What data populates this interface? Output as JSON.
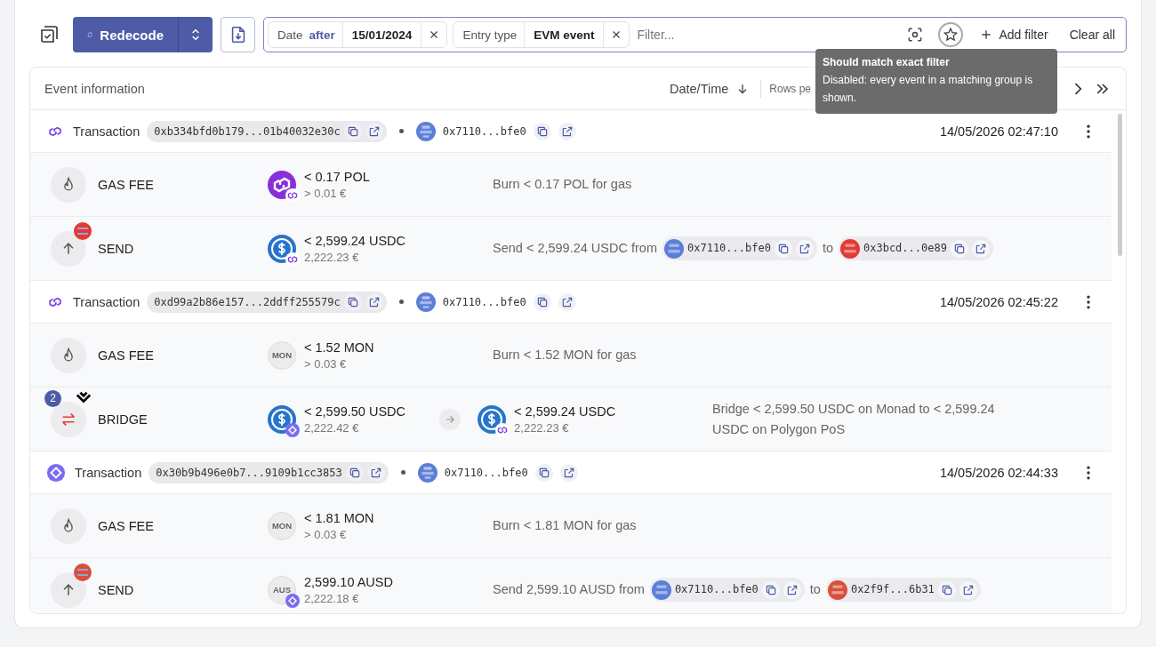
{
  "toolbar": {
    "redecode": "Redecode"
  },
  "filter_bar": {
    "chips": [
      {
        "key": "Date",
        "operator": "after",
        "value": "15/01/2024"
      },
      {
        "key": "Entry type",
        "value": "EVM event"
      }
    ],
    "placeholder": "Filter...",
    "add": "Add filter",
    "clear": "Clear all"
  },
  "tooltip": {
    "title": "Should match exact filter",
    "text": "Disabled: every event in a matching group is shown."
  },
  "table": {
    "title": "Event information",
    "sort": "Date/Time",
    "rows_per_page": "Rows pe"
  },
  "groups": [
    {
      "kind": "polygon",
      "label": "Transaction",
      "hash": "0xb334bfd0b179...01b40032e30c",
      "wallet": {
        "text": "0x7110...bfe0",
        "color": "#5b7fd8"
      },
      "datetime": "14/05/2026 02:47:10",
      "events": [
        {
          "kind": "gas",
          "label": "GAS FEE",
          "assets": [
            {
              "token": {
                "kind": "pol"
              },
              "network": {
                "kind": "polygon"
              },
              "amount": "< 0.17 POL",
              "value": "> 0.01 €"
            }
          ],
          "description": [
            {
              "kind": "text",
              "text": "Burn < 0.17 POL for gas"
            }
          ]
        },
        {
          "kind": "send",
          "label": "SEND",
          "counterparty": {
            "color": "#e53935"
          },
          "assets": [
            {
              "token": {
                "kind": "usdc"
              },
              "network": {
                "kind": "polygon"
              },
              "amount": "< 2,599.24 USDC",
              "value": "2,222.23 €"
            }
          ],
          "description": [
            {
              "kind": "text",
              "text": "Send < 2,599.24 USDC from"
            },
            {
              "kind": "address",
              "text": "0x7110...bfe0",
              "color": "#5b7fd8"
            },
            {
              "kind": "text",
              "text": "to"
            },
            {
              "kind": "address",
              "text": "0x3bcd...0e89",
              "color": "#e53935"
            }
          ]
        }
      ]
    },
    {
      "kind": "polygon",
      "label": "Transaction",
      "hash": "0xd99a2b86e157...2ddff255579c",
      "wallet": {
        "text": "0x7110...bfe0",
        "color": "#5b7fd8"
      },
      "datetime": "14/05/2026 02:45:22",
      "events": [
        {
          "kind": "gas",
          "label": "GAS FEE",
          "assets": [
            {
              "token": {
                "kind": "symbol",
                "symbol": "MON"
              },
              "amount": "< 1.52 MON",
              "value": "> 0.03 €"
            }
          ],
          "description": [
            {
              "kind": "text",
              "text": "Burn < 1.52 MON for gas"
            }
          ]
        },
        {
          "kind": "bridge",
          "label": "BRIDGE",
          "count": "2",
          "assets": [
            {
              "token": {
                "kind": "usdc"
              },
              "network": {
                "kind": "monad"
              },
              "amount": "< 2,599.50 USDC",
              "value": "2,222.42 €"
            },
            {
              "token": {
                "kind": "usdc"
              },
              "network": {
                "kind": "polygon"
              },
              "amount": "< 2,599.24 USDC",
              "value": "2,222.23 €"
            }
          ],
          "description": [
            {
              "kind": "text",
              "text": "Bridge < 2,599.50 USDC on Monad to < 2,599.24 USDC on Polygon PoS"
            }
          ]
        }
      ]
    },
    {
      "kind": "monad",
      "label": "Transaction",
      "hash": "0x30b9b496e0b7...9109b1cc3853",
      "wallet": {
        "text": "0x7110...bfe0",
        "color": "#5b7fd8"
      },
      "datetime": "14/05/2026 02:44:33",
      "events": [
        {
          "kind": "gas",
          "label": "GAS FEE",
          "assets": [
            {
              "token": {
                "kind": "symbol",
                "symbol": "MON"
              },
              "amount": "< 1.81 MON",
              "value": "> 0.03 €"
            }
          ],
          "description": [
            {
              "kind": "text",
              "text": "Burn < 1.81 MON for gas"
            }
          ]
        },
        {
          "kind": "send",
          "label": "SEND",
          "counterparty": {
            "color": "#d8503a"
          },
          "assets": [
            {
              "token": {
                "kind": "symbol",
                "symbol": "AUS"
              },
              "network": {
                "kind": "monad"
              },
              "amount": "2,599.10 AUSD",
              "value": "2,222.18 €"
            }
          ],
          "description": [
            {
              "kind": "text",
              "text": "Send 2,599.10 AUSD from"
            },
            {
              "kind": "address",
              "text": "0x7110...bfe0",
              "color": "#5b7fd8"
            },
            {
              "kind": "text",
              "text": "to"
            },
            {
              "kind": "address",
              "text": "0x2f9f...6b31",
              "color": "#d8503a"
            }
          ]
        }
      ]
    }
  ]
}
